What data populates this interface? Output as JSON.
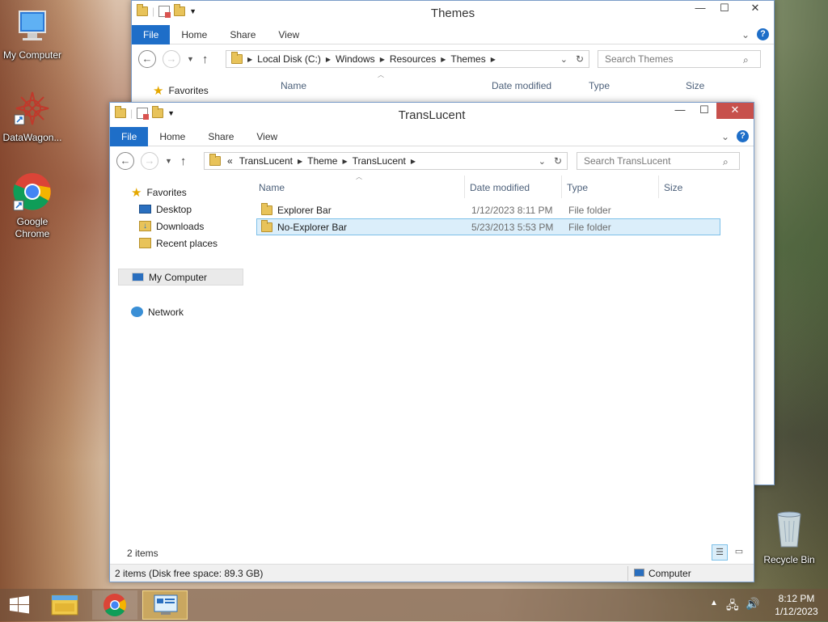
{
  "desktop": {
    "icons": [
      {
        "label": "My Computer"
      },
      {
        "label": "DataWagon..."
      },
      {
        "label": "Google Chrome"
      },
      {
        "label": "Recycle Bin"
      }
    ]
  },
  "themes_window": {
    "title": "Themes",
    "tabs": [
      "File",
      "Home",
      "Share",
      "View"
    ],
    "breadcrumb": [
      "Local Disk (C:)",
      "Windows",
      "Resources",
      "Themes"
    ],
    "search_placeholder": "Search Themes",
    "columns": [
      "Name",
      "Date modified",
      "Type",
      "Size"
    ],
    "nav": {
      "favorites": "Favorites"
    }
  },
  "translucent_window": {
    "title": "TransLucent",
    "tabs": [
      "File",
      "Home",
      "Share",
      "View"
    ],
    "breadcrumb_prefix": "«",
    "breadcrumb": [
      "TransLucent",
      "Theme",
      "TransLucent"
    ],
    "search_placeholder": "Search TransLucent",
    "columns": [
      "Name",
      "Date modified",
      "Type",
      "Size"
    ],
    "nav": {
      "favorites": "Favorites",
      "desktop": "Desktop",
      "downloads": "Downloads",
      "recent": "Recent places",
      "my_computer": "My Computer",
      "network": "Network"
    },
    "files": [
      {
        "name": "Explorer Bar",
        "date": "1/12/2023 8:11 PM",
        "type": "File folder",
        "size": ""
      },
      {
        "name": "No-Explorer Bar",
        "date": "5/23/2013 5:53 PM",
        "type": "File folder",
        "size": ""
      }
    ],
    "item_count": "2 items",
    "status_left": "2 items (Disk free space: 89.3 GB)",
    "status_right": "Computer"
  },
  "taskbar": {
    "time": "8:12 PM",
    "date": "1/12/2023"
  },
  "colors": {
    "file_tab": "#1e6ec8",
    "close_button": "#c7504c",
    "selection": "#dbeefa"
  }
}
